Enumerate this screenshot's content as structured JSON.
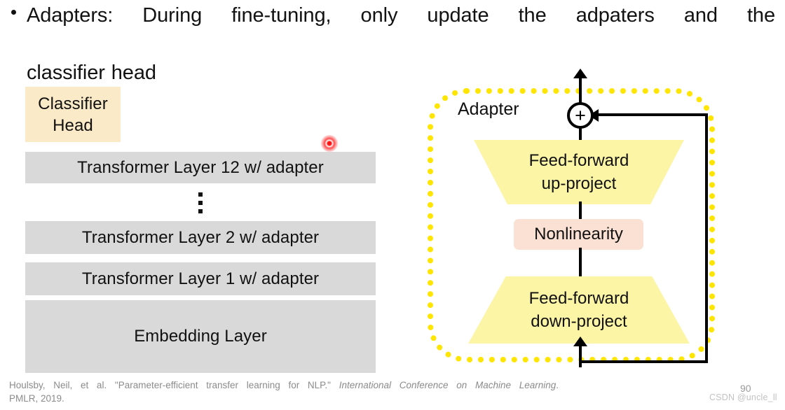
{
  "slide": {
    "title_line_1": "Adapters:  During  fine-tuning,  only  update  the  adpaters  and  the",
    "title_line_2": "classifier head",
    "bullet_glyph": "•"
  },
  "left_stack": {
    "classifier_head": {
      "line_1": "Classifier",
      "line_2": "Head",
      "color": "#FBEAC8"
    },
    "layers": [
      {
        "label": "Transformer Layer 12 w/ adapter",
        "color": "#D9D9D9"
      },
      {
        "label": "Transformer Layer 2 w/ adapter",
        "color": "#D9D9D9"
      },
      {
        "label": "Transformer Layer 1 w/ adapter",
        "color": "#D9D9D9"
      }
    ],
    "embedding": {
      "label": "Embedding Layer",
      "color": "#D9D9D9"
    },
    "ellipsis": "⋮"
  },
  "adapter": {
    "title": "Adapter",
    "border_color": "#FFE500",
    "plus_node": "+",
    "up_project": {
      "line_1": "Feed-forward",
      "line_2": "up-project",
      "color": "#FCF5A6"
    },
    "nonlinearity": {
      "label": "Nonlinearity",
      "color": "#FBE1D3"
    },
    "down_project": {
      "line_1": "Feed-forward",
      "line_2": "down-project",
      "color": "#FCF5A6"
    }
  },
  "footer": {
    "citation_part_1": "Houlsby, Neil, et al. \"Parameter-efficient transfer learning for NLP.\" ",
    "citation_italic": "International Conference on Machine Learning",
    "citation_part_2": ".",
    "citation_line_2": "PMLR, 2019.",
    "page_number": "90",
    "watermark": "CSDN @uncle_ll"
  },
  "cursor": {
    "color": "#FF0000"
  }
}
